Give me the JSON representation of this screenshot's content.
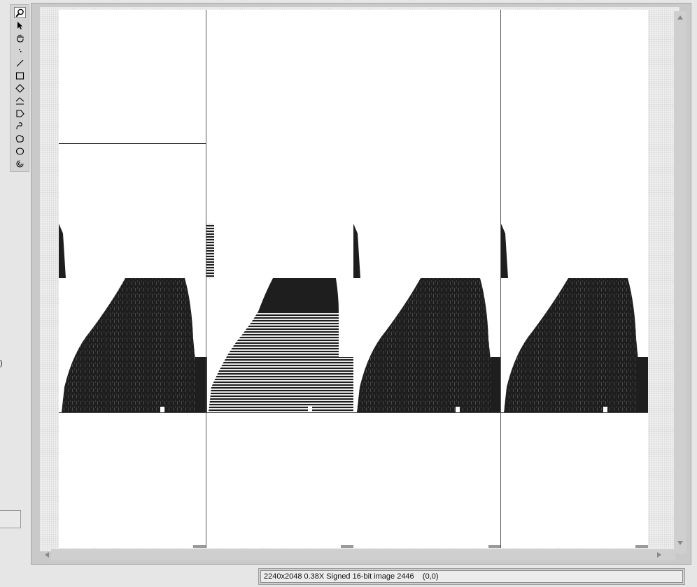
{
  "tools": [
    {
      "name": "zoom-icon",
      "active": true
    },
    {
      "name": "pointer-icon",
      "active": false
    },
    {
      "name": "pan-hand-icon",
      "active": false
    },
    {
      "name": "point-icon",
      "active": false
    },
    {
      "name": "line-icon",
      "active": false
    },
    {
      "name": "rectangle-icon",
      "active": false
    },
    {
      "name": "rotated-rectangle-icon",
      "active": false
    },
    {
      "name": "polyline-icon",
      "active": false
    },
    {
      "name": "polygon-icon",
      "active": false
    },
    {
      "name": "freehand-line-icon",
      "active": false
    },
    {
      "name": "freehand-region-icon",
      "active": false
    },
    {
      "name": "oval-icon",
      "active": false
    },
    {
      "name": "annulus-icon",
      "active": false
    }
  ],
  "left_cutoff_text": ")",
  "status": {
    "image_info": "2240x2048 0.38X Signed 16-bit image 2446",
    "cursor_coords": "(0,0)"
  },
  "colors": {
    "background": "#e6e6e6",
    "image_dark": "#1e1e1e"
  }
}
